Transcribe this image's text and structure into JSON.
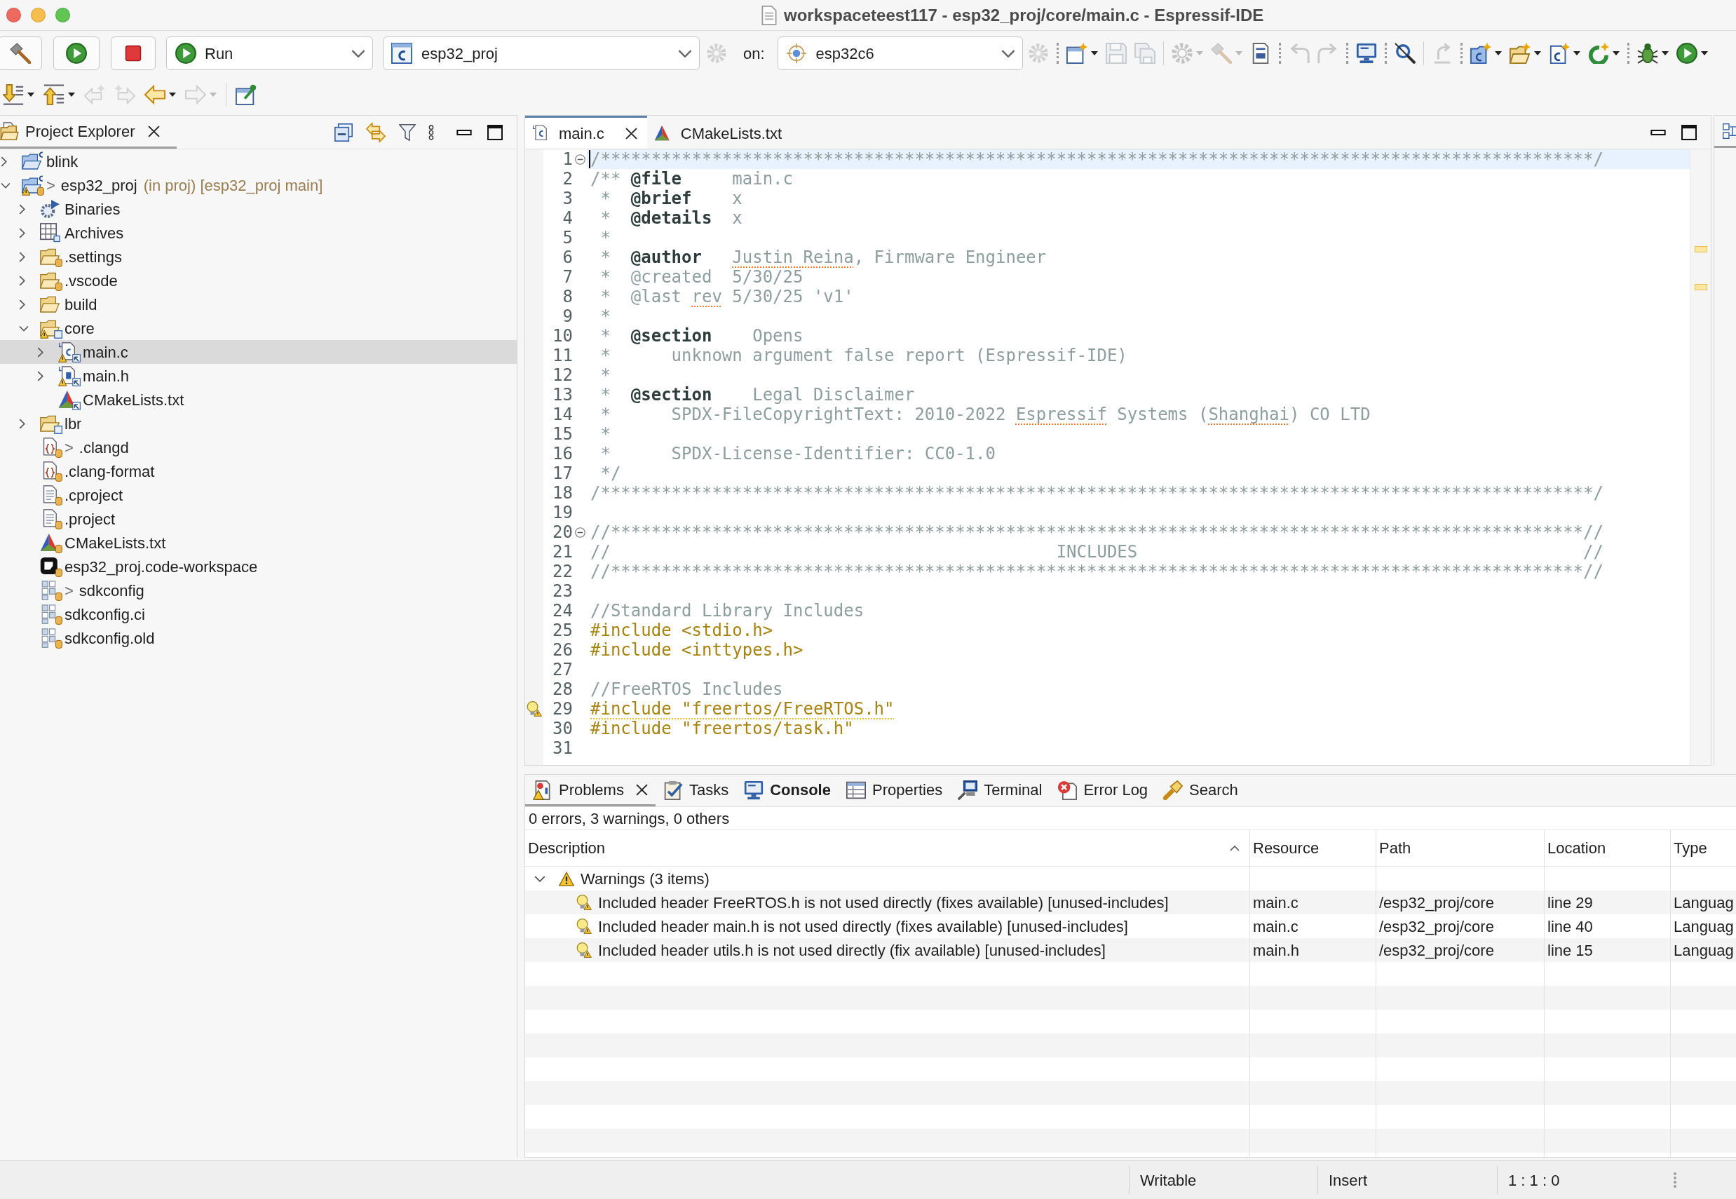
{
  "window": {
    "title": "workspaceteest117 - esp32_proj/core/main.c - Espressif-IDE"
  },
  "toolbar": {
    "launch_mode": "Run",
    "launch_config": "esp32_proj",
    "target_prefix": "on:",
    "target": "esp32c6",
    "tools": [
      {
        "kind": "dot-divider"
      },
      {
        "kind": "new-window",
        "disabled": false,
        "dropdown": true
      },
      {
        "kind": "save",
        "disabled": true,
        "dropdown": false
      },
      {
        "kind": "save-all",
        "disabled": true,
        "dropdown": false
      },
      {
        "kind": "line-divider"
      },
      {
        "kind": "build-config",
        "disabled": true,
        "dropdown": true
      },
      {
        "kind": "hammer",
        "disabled": true,
        "dropdown": true
      },
      {
        "kind": "binary",
        "disabled": false,
        "dropdown": false
      },
      {
        "kind": "dot-divider"
      },
      {
        "kind": "undo",
        "disabled": true,
        "dropdown": false
      },
      {
        "kind": "redo",
        "disabled": true,
        "dropdown": false
      },
      {
        "kind": "dot-divider"
      },
      {
        "kind": "monitor",
        "disabled": false,
        "dropdown": false
      },
      {
        "kind": "dot-divider"
      },
      {
        "kind": "disconnect",
        "disabled": false,
        "dropdown": false
      },
      {
        "kind": "line-divider"
      },
      {
        "kind": "refresh",
        "disabled": true,
        "dropdown": false
      },
      {
        "kind": "dot-divider"
      },
      {
        "kind": "new-c-project",
        "disabled": false,
        "dropdown": true
      },
      {
        "kind": "new-folder",
        "disabled": false,
        "dropdown": true
      },
      {
        "kind": "new-c-file",
        "disabled": false,
        "dropdown": true
      },
      {
        "kind": "sync",
        "disabled": false,
        "dropdown": true
      },
      {
        "kind": "dot-divider"
      },
      {
        "kind": "bug",
        "disabled": false,
        "dropdown": true
      },
      {
        "kind": "run",
        "disabled": false,
        "dropdown": true
      }
    ]
  },
  "navigation_toolbar": {
    "tools": [
      {
        "kind": "next-annotation",
        "disabled": false,
        "dropdown": true
      },
      {
        "kind": "prev-annotation",
        "disabled": false,
        "dropdown": true
      },
      {
        "kind": "back-edit",
        "disabled": true,
        "dropdown": false
      },
      {
        "kind": "forward-edit",
        "disabled": true,
        "dropdown": false
      },
      {
        "kind": "back",
        "disabled": false,
        "dropdown": true
      },
      {
        "kind": "forward",
        "disabled": true,
        "dropdown": true
      },
      {
        "kind": "line-divider"
      },
      {
        "kind": "pin-editor",
        "disabled": false,
        "dropdown": false
      }
    ]
  },
  "explorer": {
    "title": "Project Explorer",
    "tree": [
      {
        "label": "blink",
        "kind": "c-project",
        "expanded": false,
        "tracked": false,
        "warning": false,
        "selected": false
      },
      {
        "prefix": ">",
        "label": "esp32_proj",
        "decoration": "(in proj) [esp32_proj main]",
        "kind": "c-project",
        "expanded": true,
        "tracked": true,
        "warning": true,
        "selected": false,
        "children": [
          {
            "label": "Binaries",
            "kind": "binaries",
            "expanded": false,
            "tracked": false,
            "warning": false,
            "selected": false
          },
          {
            "label": "Archives",
            "kind": "archives",
            "expanded": false,
            "tracked": false,
            "warning": false,
            "selected": false
          },
          {
            "label": ".settings",
            "kind": "folder",
            "expanded": false,
            "tracked": true,
            "warning": false,
            "selected": false
          },
          {
            "label": ".vscode",
            "kind": "folder",
            "expanded": false,
            "tracked": true,
            "warning": false,
            "selected": false
          },
          {
            "label": "build",
            "kind": "folder",
            "expanded": false,
            "tracked": false,
            "warning": false,
            "selected": false
          },
          {
            "label": "core",
            "kind": "source-folder",
            "expanded": true,
            "tracked": false,
            "warning": true,
            "selected": false,
            "children": [
              {
                "label": "main.c",
                "kind": "c-source",
                "expanded": false,
                "tracked": false,
                "warning": true,
                "selected": true
              },
              {
                "label": "main.h",
                "kind": "c-header",
                "expanded": false,
                "tracked": false,
                "warning": true,
                "selected": false
              },
              {
                "label": "CMakeLists.txt",
                "kind": "linked-cmake",
                "tracked": false,
                "warning": false,
                "selected": false
              }
            ]
          },
          {
            "label": "lbr",
            "kind": "source-folder",
            "expanded": false,
            "tracked": false,
            "warning": false,
            "selected": false
          },
          {
            "prefix": ">",
            "label": ".clangd",
            "kind": "config",
            "tracked": true,
            "warning": false,
            "selected": false
          },
          {
            "label": ".clang-format",
            "kind": "config",
            "tracked": true,
            "warning": false,
            "selected": false
          },
          {
            "label": ".cproject",
            "kind": "text-file",
            "tracked": true,
            "warning": false,
            "selected": false
          },
          {
            "label": ".project",
            "kind": "text-file",
            "tracked": true,
            "warning": false,
            "selected": false
          },
          {
            "label": "CMakeLists.txt",
            "kind": "cmake",
            "tracked": true,
            "warning": false,
            "selected": false
          },
          {
            "label": "esp32_proj.code-workspace",
            "kind": "workspace",
            "tracked": true,
            "warning": false,
            "selected": false
          },
          {
            "prefix": ">",
            "label": "sdkconfig",
            "kind": "sdkconfig",
            "tracked": true,
            "warning": false,
            "selected": false
          },
          {
            "label": "sdkconfig.ci",
            "kind": "sdkconfig",
            "tracked": true,
            "warning": false,
            "selected": false
          },
          {
            "label": "sdkconfig.old",
            "kind": "sdkconfig",
            "tracked": true,
            "warning": false,
            "selected": false
          }
        ]
      }
    ]
  },
  "editor": {
    "tabs": [
      {
        "label": "main.c",
        "kind": "c-file",
        "selected": true
      },
      {
        "label": "CMakeLists.txt",
        "kind": "cmake",
        "selected": false
      }
    ],
    "lines": [
      {
        "n": "1",
        "segments": [
          {
            "text": "/**************************************************************************************************/",
            "kind": "comment"
          }
        ],
        "current": true,
        "fold": true,
        "warning": false
      },
      {
        "n": "2",
        "segments": [
          {
            "text": "/** ",
            "kind": "comment"
          },
          {
            "text": "@file",
            "kind": "tag"
          },
          {
            "text": "     main.c",
            "kind": "comment"
          }
        ],
        "current": false,
        "fold": false,
        "warning": false
      },
      {
        "n": "3",
        "segments": [
          {
            "text": " *  ",
            "kind": "comment"
          },
          {
            "text": "@brief",
            "kind": "tag"
          },
          {
            "text": "    x",
            "kind": "comment"
          }
        ],
        "current": false,
        "fold": false,
        "warning": false
      },
      {
        "n": "4",
        "segments": [
          {
            "text": " *  ",
            "kind": "comment"
          },
          {
            "text": "@details",
            "kind": "tag"
          },
          {
            "text": "  x",
            "kind": "comment"
          }
        ],
        "current": false,
        "fold": false,
        "warning": false
      },
      {
        "n": "5",
        "segments": [
          {
            "text": " *",
            "kind": "comment"
          }
        ],
        "current": false,
        "fold": false,
        "warning": false
      },
      {
        "n": "6",
        "segments": [
          {
            "text": " *  ",
            "kind": "comment"
          },
          {
            "text": "@author   ",
            "kind": "tag"
          },
          {
            "text": "Justin Reina",
            "kind": "comment",
            "misspelled": true
          },
          {
            "text": ", Firmware Engineer",
            "kind": "comment"
          }
        ],
        "current": false,
        "fold": false,
        "warning": false
      },
      {
        "n": "7",
        "segments": [
          {
            "text": " *  @created  5/30/25",
            "kind": "comment"
          }
        ],
        "current": false,
        "fold": false,
        "warning": false
      },
      {
        "n": "8",
        "segments": [
          {
            "text": " *  @last ",
            "kind": "comment"
          },
          {
            "text": "rev",
            "kind": "comment",
            "misspelled": true
          },
          {
            "text": " 5/30/25 'v1'",
            "kind": "comment"
          }
        ],
        "current": false,
        "fold": false,
        "warning": false
      },
      {
        "n": "9",
        "segments": [
          {
            "text": " *",
            "kind": "comment"
          }
        ],
        "current": false,
        "fold": false,
        "warning": false
      },
      {
        "n": "10",
        "segments": [
          {
            "text": " *  ",
            "kind": "comment"
          },
          {
            "text": "@section",
            "kind": "tag"
          },
          {
            "text": "    Opens",
            "kind": "comment"
          }
        ],
        "current": false,
        "fold": false,
        "warning": false
      },
      {
        "n": "11",
        "segments": [
          {
            "text": " *      unknown argument false report (Espressif-IDE)",
            "kind": "comment"
          }
        ],
        "current": false,
        "fold": false,
        "warning": false
      },
      {
        "n": "12",
        "segments": [
          {
            "text": " *",
            "kind": "comment"
          }
        ],
        "current": false,
        "fold": false,
        "warning": false
      },
      {
        "n": "13",
        "segments": [
          {
            "text": " *  ",
            "kind": "comment"
          },
          {
            "text": "@section",
            "kind": "tag"
          },
          {
            "text": "    Legal Disclaimer",
            "kind": "comment"
          }
        ],
        "current": false,
        "fold": false,
        "warning": false
      },
      {
        "n": "14",
        "segments": [
          {
            "text": " *      SPDX-FileCopyrightText: 2010-2022 ",
            "kind": "comment"
          },
          {
            "text": "Espressif",
            "kind": "comment",
            "misspelled": true
          },
          {
            "text": " Systems (",
            "kind": "comment"
          },
          {
            "text": "Shanghai",
            "kind": "comment",
            "misspelled": true
          },
          {
            "text": ") CO LTD",
            "kind": "comment"
          }
        ],
        "current": false,
        "fold": false,
        "warning": false
      },
      {
        "n": "15",
        "segments": [
          {
            "text": " *",
            "kind": "comment"
          }
        ],
        "current": false,
        "fold": false,
        "warning": false
      },
      {
        "n": "16",
        "segments": [
          {
            "text": " *      SPDX-License-Identifier: CC0-1.0",
            "kind": "comment"
          }
        ],
        "current": false,
        "fold": false,
        "warning": false
      },
      {
        "n": "17",
        "segments": [
          {
            "text": " */",
            "kind": "comment"
          }
        ],
        "current": false,
        "fold": false,
        "warning": false
      },
      {
        "n": "18",
        "segments": [
          {
            "text": "/**************************************************************************************************/",
            "kind": "comment"
          }
        ],
        "current": false,
        "fold": false,
        "warning": false
      },
      {
        "n": "19",
        "current": false,
        "fold": false,
        "warning": false
      },
      {
        "n": "20",
        "segments": [
          {
            "text": "//************************************************************************************************//",
            "kind": "comment"
          }
        ],
        "current": false,
        "fold": true,
        "warning": false
      },
      {
        "n": "21",
        "segments": [
          {
            "text": "//                                            INCLUDES                                            //",
            "kind": "comment"
          }
        ],
        "current": false,
        "fold": false,
        "warning": false
      },
      {
        "n": "22",
        "segments": [
          {
            "text": "//************************************************************************************************//",
            "kind": "comment"
          }
        ],
        "current": false,
        "fold": false,
        "warning": false
      },
      {
        "n": "23",
        "current": false,
        "fold": false,
        "warning": false
      },
      {
        "n": "24",
        "segments": [
          {
            "text": "//Standard Library Includes",
            "kind": "comment"
          }
        ],
        "current": false,
        "fold": false,
        "warning": false
      },
      {
        "n": "25",
        "segments": [
          {
            "text": "#include <stdio.h>",
            "kind": "directive"
          }
        ],
        "current": false,
        "fold": false,
        "warning": false
      },
      {
        "n": "26",
        "segments": [
          {
            "text": "#include <inttypes.h>",
            "kind": "directive"
          }
        ],
        "current": false,
        "fold": false,
        "warning": false
      },
      {
        "n": "27",
        "current": false,
        "fold": false,
        "warning": false
      },
      {
        "n": "28",
        "segments": [
          {
            "text": "//FreeRTOS Includes",
            "kind": "comment"
          }
        ],
        "current": false,
        "fold": false,
        "warning": false
      },
      {
        "n": "29",
        "segments": [
          {
            "text": "#include \"freertos/FreeRTOS.h\"",
            "kind": "directive",
            "warned": true
          }
        ],
        "current": false,
        "fold": false,
        "warning": true
      },
      {
        "n": "30",
        "segments": [
          {
            "text": "#include \"freertos/task.h\"",
            "kind": "directive"
          }
        ],
        "current": false,
        "fold": false,
        "warning": false
      },
      {
        "n": "31",
        "current": false,
        "fold": false,
        "warning": false
      }
    ]
  },
  "bottom_panel": {
    "tabs": [
      {
        "label": "Problems",
        "kind": "problems",
        "selected": true,
        "highlighted": false
      },
      {
        "label": "Tasks",
        "kind": "tasks",
        "selected": false,
        "highlighted": false
      },
      {
        "label": "Console",
        "kind": "console",
        "selected": false,
        "highlighted": true
      },
      {
        "label": "Properties",
        "kind": "properties",
        "selected": false,
        "highlighted": false
      },
      {
        "label": "Terminal",
        "kind": "terminal",
        "selected": false,
        "highlighted": false
      },
      {
        "label": "Error Log",
        "kind": "error-log",
        "selected": false,
        "highlighted": false
      },
      {
        "label": "Search",
        "kind": "search",
        "selected": false,
        "highlighted": false
      }
    ],
    "problems": {
      "summary": "0 errors, 3 warnings, 0 others",
      "columns": [
        {
          "label": "Description",
          "sorted": true
        },
        {
          "label": "Resource",
          "sorted": false
        },
        {
          "label": "Path",
          "sorted": false
        },
        {
          "label": "Location",
          "sorted": false
        },
        {
          "label": "Type",
          "sorted": false
        }
      ],
      "groups": [
        {
          "label": "Warnings (3 items)",
          "expanded": true,
          "rows": [
            {
              "cells": [
                "Included header FreeRTOS.h is not used directly (fixes available) [unused-includes]",
                "main.c",
                "/esp32_proj/core",
                "line 29",
                "Languag"
              ],
              "selected": false
            },
            {
              "cells": [
                "Included header main.h is not used directly (fixes available) [unused-includes]",
                "main.c",
                "/esp32_proj/core",
                "line 40",
                "Languag"
              ],
              "selected": false
            },
            {
              "cells": [
                "Included header utils.h is not used directly (fix available) [unused-includes]",
                "main.h",
                "/esp32_proj/core",
                "line 15",
                "Languag"
              ],
              "selected": false
            }
          ]
        }
      ]
    }
  },
  "status_bar": [
    "Writable",
    "Insert",
    "1 : 1 : 0"
  ]
}
